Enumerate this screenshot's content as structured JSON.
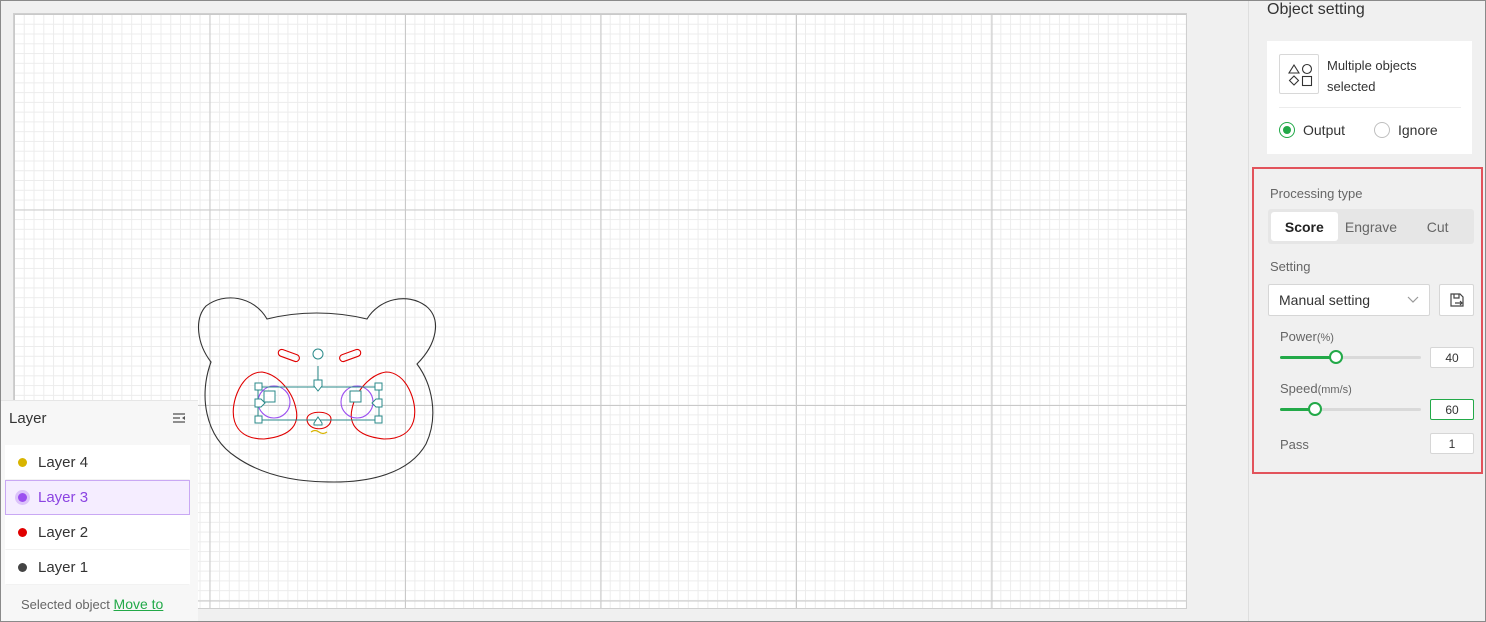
{
  "colors": {
    "accent": "#22a948",
    "highlight_border": "#e2535b",
    "layer_selected": "#8b44e2"
  },
  "layer_panel": {
    "title": "Layer",
    "menu_icon": "collapse-menu-icon",
    "layers": [
      {
        "name": "Layer 4",
        "color": "#d8b400",
        "selected": false
      },
      {
        "name": "Layer 3",
        "color": "#9b4ff0",
        "selected": true
      },
      {
        "name": "Layer 2",
        "color": "#e00000",
        "selected": false
      },
      {
        "name": "Layer 1",
        "color": "#444444",
        "selected": false
      }
    ],
    "footer_text": "Selected object",
    "move_link": "Move to"
  },
  "object_setting": {
    "title": "Object setting",
    "icon": "shapes-icon",
    "selection_label": "Multiple objects selected",
    "output_label": "Output",
    "ignore_label": "Ignore",
    "output_selected": true
  },
  "processing": {
    "type_label": "Processing type",
    "types": [
      "Score",
      "Engrave",
      "Cut"
    ],
    "active_type": "Score",
    "setting_label": "Setting",
    "setting_value": "Manual setting",
    "save_icon": "save-preset-icon",
    "power_label": "Power",
    "power_unit": "(%)",
    "power_value": "40",
    "power_fraction": 0.4,
    "speed_label": "Speed",
    "speed_unit": "(mm/s)",
    "speed_value": "60",
    "speed_fraction": 0.25,
    "pass_label": "Pass",
    "pass_value": "1"
  }
}
